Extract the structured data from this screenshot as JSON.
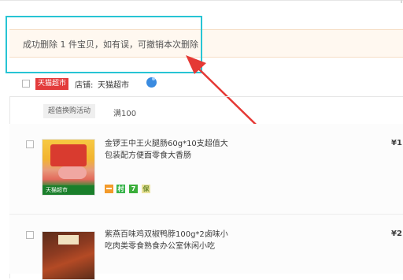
{
  "notice": {
    "text": "成功删除 1 件宝贝，如有误，可撤销本次删除"
  },
  "shop": {
    "badge": "天猫超市",
    "label": "店铺:",
    "name": "天猫超市"
  },
  "promo": {
    "tag": "超值换购活动",
    "amount": "满100"
  },
  "items": [
    {
      "title_line1": "金锣王中王火腿肠60g*10支超值大",
      "title_line2": "包装配方便面零食大香肠",
      "price": "¥1",
      "thumb_footer": "天猫超市",
      "service_icons": [
        "card-icon",
        "green-service-icon",
        "seven-day-return-icon",
        "guarantee-icon"
      ],
      "service_glyphs": [
        "",
        "村",
        "7",
        "保"
      ]
    },
    {
      "title_line1": "紫燕百味鸡双椒鸭脖100g*2卤味小",
      "title_line2": "吃肉类零食熟食办公室休闲小吃",
      "price": "¥2"
    }
  ],
  "colors": {
    "highlight_border": "#27c4d4",
    "arrow": "#e53935",
    "notice_bg": "#fff8f0",
    "tmall_badge": "#e33b3b"
  }
}
